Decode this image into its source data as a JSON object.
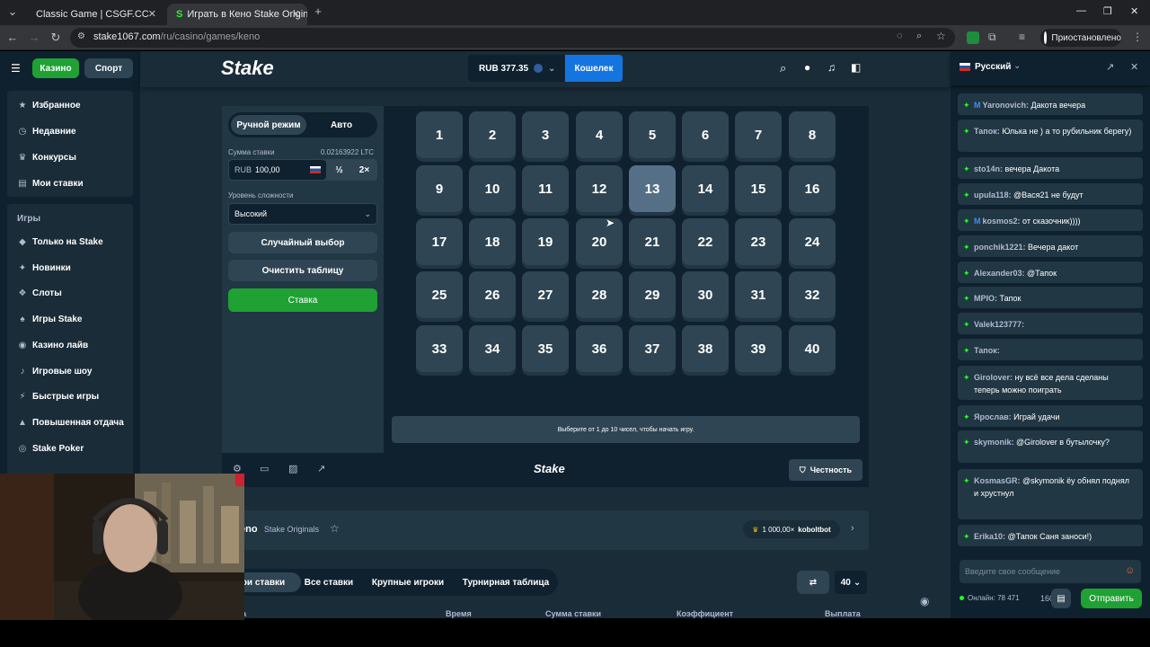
{
  "browser": {
    "tabs": [
      {
        "title": "Classic Game | CSGF.CC"
      },
      {
        "title": "Играть в Кено Stake Original о"
      }
    ],
    "url_host": "stake1067.com",
    "url_path": "/ru/casino/games/keno",
    "profile_label": "Приостановлено"
  },
  "header": {
    "casino": "Казино",
    "sport": "Спорт",
    "logo": "Stake",
    "balance": "RUB 377.35",
    "wallet": "Кошелек"
  },
  "sidebar": {
    "items_top": [
      {
        "label": "Избранное",
        "icon": "★"
      },
      {
        "label": "Недавние",
        "icon": "●"
      },
      {
        "label": "Конкурсы",
        "icon": "●"
      },
      {
        "label": "Мои ставки",
        "icon": "●"
      }
    ],
    "section": "Игры",
    "items": [
      {
        "label": "Только на Stake",
        "icon": "●"
      },
      {
        "label": "Новинки",
        "icon": "✦"
      },
      {
        "label": "Слоты",
        "icon": "●"
      },
      {
        "label": "Игры Stake",
        "icon": "●"
      },
      {
        "label": "Казино лайв",
        "icon": "●"
      },
      {
        "label": "Игровые шоу",
        "icon": "●"
      },
      {
        "label": "Быстрые игры",
        "icon": "●"
      },
      {
        "label": "Повышенная отдача",
        "icon": "●"
      },
      {
        "label": "Stake Poker",
        "icon": "●"
      }
    ]
  },
  "panel": {
    "mode_manual": "Ручной режим",
    "mode_auto": "Авто",
    "bet_label": "Сумма ставки",
    "bet_crypto": "0.02163922 LTC",
    "bet_currency": "RUB",
    "bet_value": "100,00",
    "half": "½",
    "double": "2×",
    "risk_label": "Уровень сложности",
    "risk_value": "Высокий",
    "random_pick": "Случайный выбор",
    "clear_table": "Очистить таблицу",
    "bet_button": "Ставка"
  },
  "board": {
    "numbers": [
      "1",
      "2",
      "3",
      "4",
      "5",
      "6",
      "7",
      "8",
      "9",
      "10",
      "11",
      "12",
      "13",
      "14",
      "15",
      "16",
      "17",
      "18",
      "19",
      "20",
      "21",
      "22",
      "23",
      "24",
      "25",
      "26",
      "27",
      "28",
      "29",
      "30",
      "31",
      "32",
      "33",
      "34",
      "35",
      "36",
      "37",
      "38",
      "39",
      "40"
    ],
    "hovered": "13",
    "message": "Выберите от 1 до 10 чисел, чтобы начать игру."
  },
  "footer": {
    "logo": "Stake",
    "fairness": "Честность"
  },
  "info": {
    "game": "eno",
    "provider": "Stake Originals",
    "top_win_amount": "1 000,00×",
    "top_win_user": "koboltbot"
  },
  "bets_tabs": {
    "tabs": [
      "ои ставки",
      "Все ставки",
      "Крупные игроки",
      "Турнирная таблица"
    ],
    "rows": "40",
    "columns": [
      "а",
      "Время",
      "Сумма ставки",
      "Коэффициент",
      "Выплата"
    ]
  },
  "chat": {
    "language": "Русский",
    "messages": [
      {
        "user": "Yaronovich:",
        "text": "Дакота вечера",
        "badge": "M"
      },
      {
        "user": "Тапок:",
        "text": "Юлька не ) а то рубильник берегу)"
      },
      {
        "user": "sto14n:",
        "text": "вечера Дакота"
      },
      {
        "user": "upula118:",
        "text": "@Вася21 не будут"
      },
      {
        "user": "kosmos2:",
        "text": "от сказочник))))",
        "badge": "M"
      },
      {
        "user": "ponchik1221:",
        "text": "Вечера дакот"
      },
      {
        "user": "Alexander03:",
        "text": "@Тапок"
      },
      {
        "user": "MPIO:",
        "text": "Тапок"
      },
      {
        "user": "Valek123777:",
        "text": ""
      },
      {
        "user": "Тапок:",
        "text": ""
      },
      {
        "user": "Girolover:",
        "text": "ну всё все дела сделаны теперь можно поиграть"
      },
      {
        "user": "Ярослав:",
        "text": "Играй удачи"
      },
      {
        "user": "skymonik:",
        "text": "@Girolover в бутылочку?"
      },
      {
        "user": "KosmasGR:",
        "text": "@skymonik ёу обнял поднял и хрустнул"
      },
      {
        "user": "Erika10:",
        "text": "@Тапок Саня заноси!)"
      }
    ],
    "input_placeholder": "Введите свое сообщение",
    "online": "Онлайн: 78 471",
    "count": "160",
    "send": "Отправить"
  }
}
